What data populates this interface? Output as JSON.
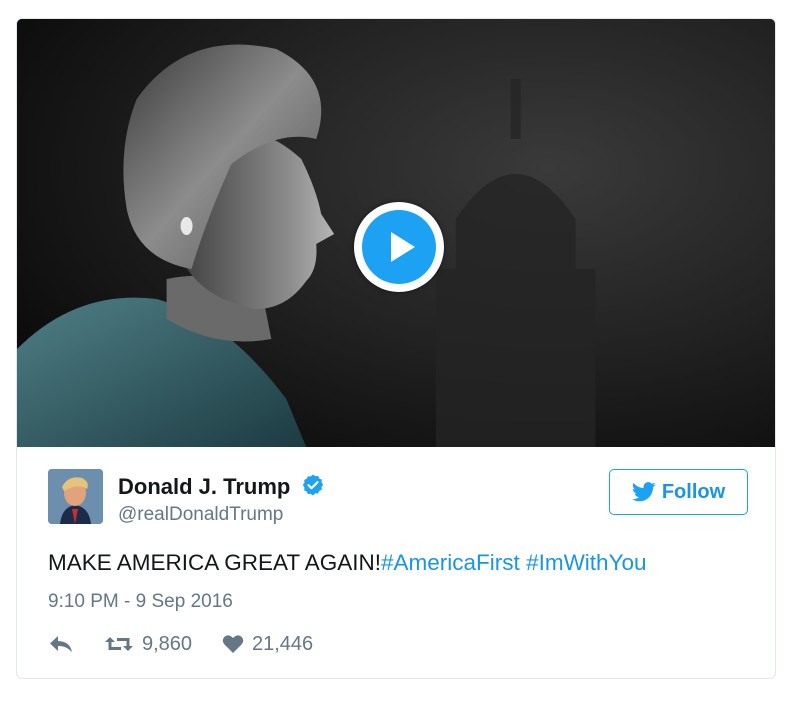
{
  "video": {
    "play_icon": "play-icon"
  },
  "author": {
    "name": "Donald J. Trump",
    "handle": "@realDonaldTrump",
    "verified_icon": "verified-badge-icon",
    "avatar": "profile-avatar"
  },
  "follow": {
    "label": "Follow",
    "icon": "twitter-bird-icon"
  },
  "tweet": {
    "text": "MAKE AMERICA GREAT AGAIN!",
    "hashtags": [
      "#AmericaFirst",
      "#ImWithYou"
    ],
    "timestamp": "9:10 PM - 9 Sep 2016"
  },
  "actions": {
    "reply_icon": "reply-icon",
    "retweet_icon": "retweet-icon",
    "retweet_count": "9,860",
    "like_icon": "heart-icon",
    "like_count": "21,446"
  },
  "colors": {
    "brand_blue": "#1da1f2",
    "link_blue": "#1b95e0",
    "muted": "#657786",
    "text": "#14171a",
    "border": "#e1e8ed"
  }
}
